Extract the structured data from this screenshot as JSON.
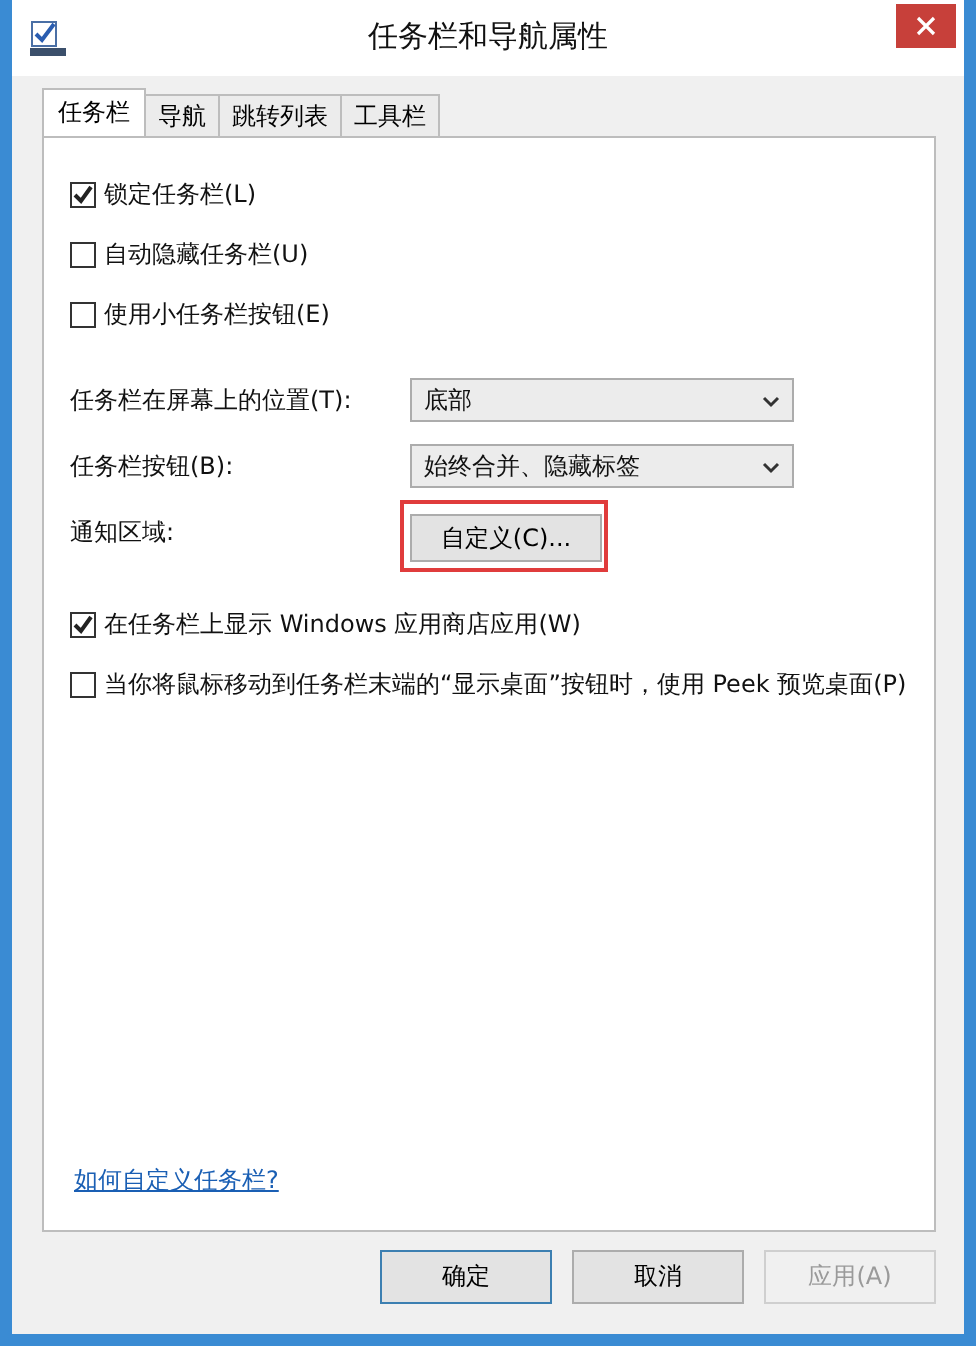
{
  "window": {
    "title": "任务栏和导航属性"
  },
  "tabs": [
    {
      "label": "任务栏",
      "selected": true
    },
    {
      "label": "导航",
      "selected": false
    },
    {
      "label": "跳转列表",
      "selected": false
    },
    {
      "label": "工具栏",
      "selected": false
    }
  ],
  "settings": [
    {
      "kind": "checkbox",
      "label": "锁定任务栏(L)",
      "checked": true
    },
    {
      "kind": "checkbox",
      "label": "自动隐藏任务栏(U)",
      "checked": false
    },
    {
      "kind": "checkbox",
      "label": "使用小任务栏按钮(E)",
      "checked": false
    },
    {
      "kind": "dropdown",
      "label": "任务栏在屏幕上的位置(T):",
      "value": "底部"
    },
    {
      "kind": "dropdown",
      "label": "任务栏按钮(B):",
      "value": "始终合并、隐藏标签"
    },
    {
      "kind": "button",
      "label": "通知区域:",
      "button": "自定义(C)...",
      "highlighted": true
    },
    {
      "kind": "checkbox",
      "label": "在任务栏上显示 Windows 应用商店应用(W)",
      "checked": true
    },
    {
      "kind": "checkbox",
      "label": "当你将鼠标移动到任务栏末端的“显示桌面”按钮时，使用 Peek 预览桌面(P)",
      "checked": false
    }
  ],
  "help_link": "如何自定义任务栏?",
  "buttons": [
    {
      "label": "确定",
      "disabled": false,
      "default": true
    },
    {
      "label": "取消",
      "disabled": false,
      "default": false
    },
    {
      "label": "应用(A)",
      "disabled": true,
      "default": false
    }
  ]
}
